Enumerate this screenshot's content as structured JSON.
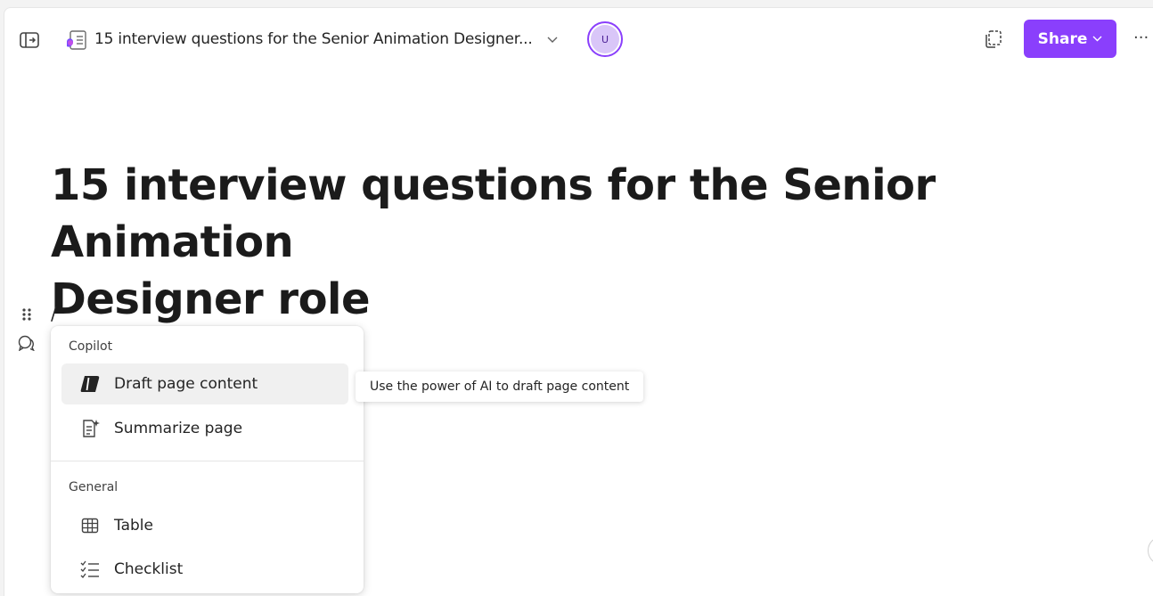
{
  "header": {
    "doc_title": "15 interview questions for the Senior Animation Designer...",
    "avatar_initial": "U",
    "share_label": "Share",
    "more_label": "···"
  },
  "page": {
    "title_line1": "15 interview questions for the Senior Animation",
    "title_line2": "Designer role",
    "slash_text": "/"
  },
  "menu": {
    "sections": [
      {
        "label": "Copilot",
        "items": [
          {
            "label": "Draft page content",
            "icon": "copilot-icon",
            "active": true
          },
          {
            "label": "Summarize page",
            "icon": "summarize-icon"
          }
        ]
      },
      {
        "label": "General",
        "items": [
          {
            "label": "Table",
            "icon": "table-icon"
          },
          {
            "label": "Checklist",
            "icon": "checklist-icon"
          }
        ]
      }
    ]
  },
  "tooltip": {
    "text": "Use the power of AI to draft page content"
  },
  "colors": {
    "accent": "#8a3ffc",
    "avatar_bg": "#d9c6f8"
  }
}
